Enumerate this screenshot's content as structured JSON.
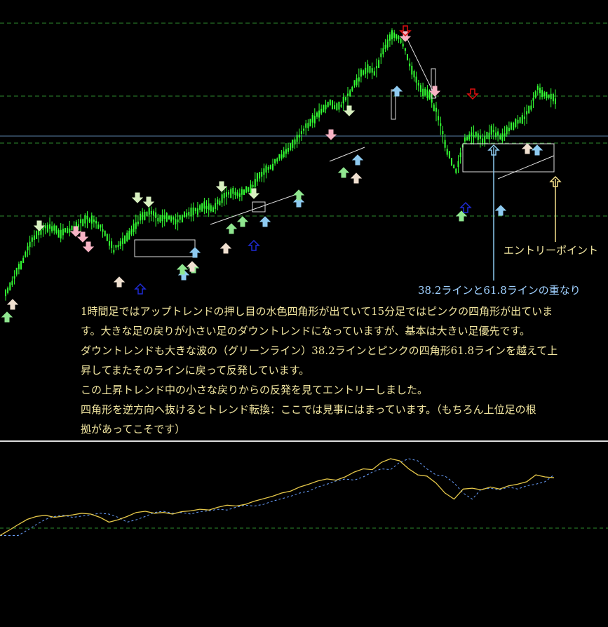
{
  "notes": {
    "line1": "1時間足ではアップトレンドの押し目の水色四角形が出ていて15分足ではピンクの四角形が出ていま",
    "line2": "す。大きな足の戻りが小さい足のダウントレンドになっていますが、基本は大きい足優先です。",
    "line3": "ダウントレンドも大きな波の（グリーンライン）38.2ラインとピンクの四角形61.8ラインを越えて上",
    "line4": "昇してまたそのラインに戻って反発しています。",
    "line5": "この上昇トレンド中の小さな戻りからの反発を見てエントリーしました。",
    "line6": "四角形を逆方向へ抜けるとトレンド転換：ここでは見事にはまっています。（もちろん上位足の根",
    "line7": "拠があってこそです）"
  },
  "annotations": {
    "entry_point": "エントリーポイント",
    "overlap": "38.2ラインと61.8ラインの重なり"
  },
  "colors": {
    "background": "#000000",
    "candles": "#33ff33",
    "fib_lines": "#2e8b2e",
    "blue_line": "#5a7fa8",
    "note_text": "#f2e6a0",
    "light_blue_arrow": "#8ecaf0",
    "pink_arrow": "#f7b3c4",
    "green_arrow": "#8fe68f",
    "dark_blue_arrow": "#1f2bd6",
    "red_arrow": "#e01010",
    "oscillator_main": "#e6c84a",
    "oscillator_signal": "#6aa0ff"
  },
  "chart_data": {
    "type": "line",
    "title": "",
    "series": [
      {
        "values": [
          0.05,
          0.18,
          0.32,
          0.45,
          0.52,
          0.55,
          0.5,
          0.53,
          0.56,
          0.6,
          0.58,
          0.5,
          0.38,
          0.44,
          0.52,
          0.62,
          0.65,
          0.6,
          0.62,
          0.58,
          0.64,
          0.66,
          0.7,
          0.68,
          0.75,
          0.8,
          0.78,
          0.82,
          0.9,
          0.96,
          1.02,
          1.1,
          1.15,
          1.25,
          1.32,
          1.4,
          1.45,
          1.42,
          1.5,
          1.62,
          1.7,
          1.68,
          1.86,
          1.95,
          1.9,
          1.7,
          1.55,
          1.52,
          1.35,
          1.1,
          0.95,
          1.2,
          1.22,
          1.18,
          1.25,
          1.2,
          1.28,
          1.32,
          1.38,
          1.55,
          1.5,
          1.48
        ]
      }
    ]
  }
}
